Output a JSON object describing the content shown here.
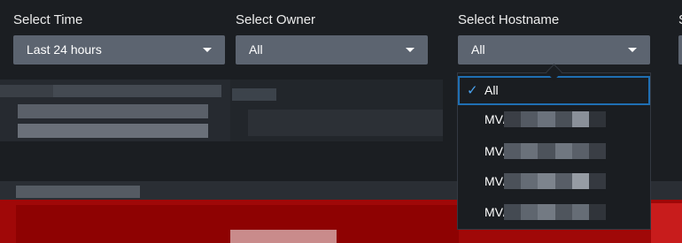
{
  "filters": {
    "time": {
      "label": "Select Time",
      "value": "Last 24 hours"
    },
    "owner": {
      "label": "Select Owner",
      "value": "All"
    },
    "hostname": {
      "label": "Select Hostname",
      "value": "All",
      "options": [
        {
          "label": "All",
          "selected": true
        },
        {
          "label": "MV/",
          "selected": false
        },
        {
          "label": "MV/",
          "selected": false
        },
        {
          "label": "MV/",
          "selected": false
        },
        {
          "label": "MV/",
          "selected": false
        }
      ]
    },
    "partial_label": "S"
  },
  "colors": {
    "background": "#1b1e22",
    "select_fill": "#5c6470",
    "accent_blue": "#1f6fb3",
    "check": "#4aa3f0",
    "alert_red": "#b01010"
  },
  "icons": {
    "caret": "chevron-down-icon",
    "check": "checkmark-icon"
  }
}
